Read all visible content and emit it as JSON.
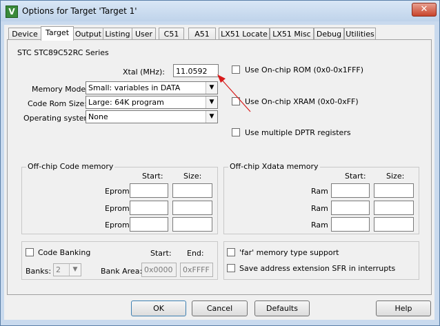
{
  "window": {
    "title": "Options for Target 'Target 1'",
    "icon_name": "keil-uvision-icon",
    "close_glyph": "✕"
  },
  "tabs": [
    {
      "label": "Device"
    },
    {
      "label": "Target"
    },
    {
      "label": "Output"
    },
    {
      "label": "Listing"
    },
    {
      "label": "User"
    },
    {
      "label": "C51"
    },
    {
      "label": "A51"
    },
    {
      "label": "LX51 Locate"
    },
    {
      "label": "LX51 Misc"
    },
    {
      "label": "Debug"
    },
    {
      "label": "Utilities"
    }
  ],
  "target": {
    "device_name": "STC STC89C52RC Series",
    "xtal_label": "Xtal (MHz):",
    "xtal_value": "11.0592",
    "memory_model_label": "Memory Model:",
    "memory_model_value": "Small: variables in DATA",
    "code_rom_label": "Code Rom Size:",
    "code_rom_value": "Large: 64K program",
    "os_label": "Operating system:",
    "os_value": "None",
    "onchip_rom_label": "Use On-chip ROM (0x0-0x1FFF)",
    "onchip_xram_label": "Use On-chip XRAM (0x0-0xFF)",
    "multi_dptr_label": "Use multiple DPTR registers"
  },
  "code_memory": {
    "title": "Off-chip Code memory",
    "start_header": "Start:",
    "size_header": "Size:",
    "rows": [
      {
        "label": "Eprom"
      },
      {
        "label": "Eprom"
      },
      {
        "label": "Eprom"
      }
    ]
  },
  "xdata_memory": {
    "title": "Off-chip Xdata memory",
    "start_header": "Start:",
    "size_header": "Size:",
    "rows": [
      {
        "label": "Ram"
      },
      {
        "label": "Ram"
      },
      {
        "label": "Ram"
      }
    ]
  },
  "banking": {
    "code_banking_label": "Code Banking",
    "start_header": "Start:",
    "end_header": "End:",
    "banks_label": "Banks:",
    "banks_value": "2",
    "bank_area_label": "Bank Area:",
    "bank_area_start": "0x0000",
    "bank_area_end": "0xFFFF"
  },
  "memory_options": {
    "far_support_label": "'far' memory type support",
    "save_sfr_label": "Save address extension SFR in interrupts"
  },
  "buttons": {
    "ok": "OK",
    "cancel": "Cancel",
    "defaults": "Defaults",
    "help": "Help"
  },
  "colors": {
    "annotation_arrow": "#d81b1b",
    "title_bar": "#c9daee"
  }
}
